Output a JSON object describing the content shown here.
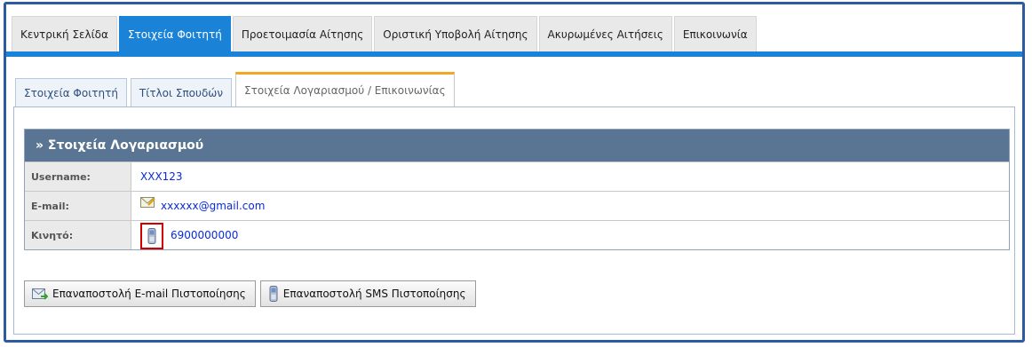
{
  "top_nav": {
    "tabs": [
      {
        "label": "Κεντρική Σελίδα",
        "active": false
      },
      {
        "label": "Στοιχεία Φοιτητή",
        "active": true
      },
      {
        "label": "Προετοιμασία Αίτησης",
        "active": false
      },
      {
        "label": "Οριστική Υποβολή Αίτησης",
        "active": false
      },
      {
        "label": "Ακυρωμένες Αιτήσεις",
        "active": false
      },
      {
        "label": "Επικοινωνία",
        "active": false
      }
    ]
  },
  "sub_tabs": [
    {
      "label": "Στοιχεία Φοιτητή",
      "active": false
    },
    {
      "label": "Τίτλοι Σπουδών",
      "active": false
    },
    {
      "label": "Στοιχεία Λογαριασμού / Επικοινωνίας",
      "active": true
    }
  ],
  "account_panel": {
    "title": "» Στοιχεία Λογαριασμού",
    "rows": {
      "username": {
        "label": "Username:",
        "value": "XXX123"
      },
      "email": {
        "label": "E-mail:",
        "value": "xxxxxx@gmail.com",
        "icon": "mail-icon"
      },
      "mobile": {
        "label": "Κινητό:",
        "value": "6900000000",
        "icon": "mobile-phone-icon"
      }
    }
  },
  "buttons": {
    "resend_email": "Επαναποστολή E-mail Πιστοποίησης",
    "resend_sms": "Επαναποστολή SMS Πιστοποίησης"
  },
  "colors": {
    "accent": "#1a83d8",
    "frame": "#2d5aa0",
    "panel_header": "#5a7593",
    "link": "#0a2bd6",
    "highlight_box": "#d10000",
    "active_subtab_border": "#f5a623"
  }
}
